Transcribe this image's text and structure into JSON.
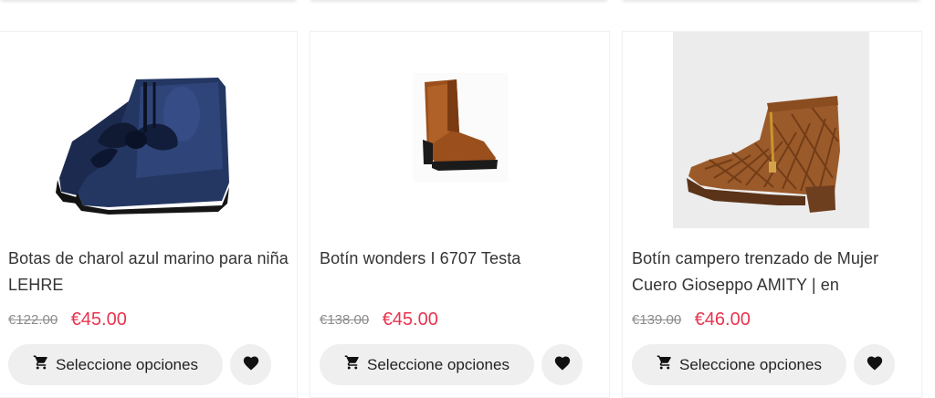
{
  "products": [
    {
      "title": "Botas de charol azul marino para niña LEHRE",
      "old_price": "€122.00",
      "new_price": "€45.00",
      "button_label": "Seleccione opciones"
    },
    {
      "title": "Botín wonders I 6707 Testa",
      "old_price": "€138.00",
      "new_price": "€45.00",
      "button_label": "Seleccione opciones"
    },
    {
      "title": "Botín campero trenzado de Mujer Cuero Gioseppo AMITY | en",
      "old_price": "€139.00",
      "new_price": "€46.00",
      "button_label": "Seleccione opciones"
    }
  ],
  "colors": {
    "sale_price": "#e9344f",
    "button_bg": "#efefef",
    "old_price": "#8c8c8c"
  },
  "icons": [
    "cart-icon",
    "heart-icon"
  ]
}
